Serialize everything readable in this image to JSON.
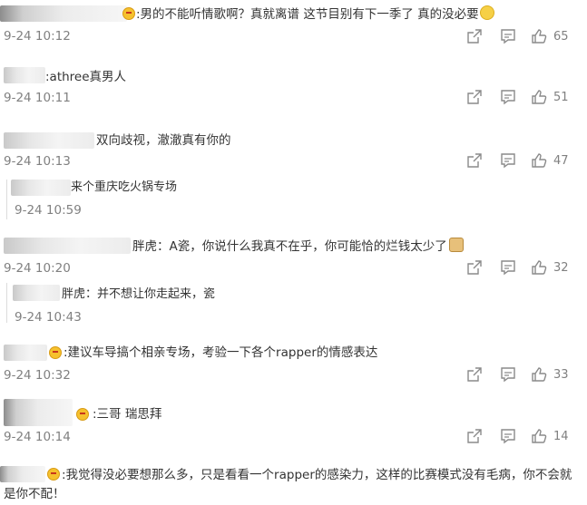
{
  "comments": [
    {
      "text": ":男的不能听情歌啊？真就离谱 这节目别有下一季了 真的没必要",
      "time": "9-24 10:12",
      "likes": "65"
    },
    {
      "text": ":athree真男人",
      "time": "9-24 10:11",
      "likes": "51"
    },
    {
      "text": "双向歧视，澈澈真有你的",
      "time": "9-24 10:13",
      "likes": "47",
      "reply": {
        "text": "来个重庆吃火锅专场",
        "time": "9-24 10:59"
      }
    },
    {
      "text": "胖虎：A瓷，你说什么我真不在乎，你可能恰的烂钱太少了",
      "time": "9-24 10:20",
      "likes": "32",
      "reply": {
        "text": "胖虎：并不想让你走起来，瓷",
        "time": "9-24 10:43"
      }
    },
    {
      "text": ":建议车导搞个相亲专场，考验一下各个rapper的情感表达",
      "time": "9-24 10:32",
      "likes": "33"
    },
    {
      "text": ":三哥 瑞思拜",
      "time": "9-24 10:14",
      "likes": "14"
    },
    {
      "text": ":我觉得没必要想那么多，只是看看一个rapper的感染力，这样的比赛模式没有毛病，你不会就是你不配！"
    }
  ],
  "icons": {
    "share": "share-icon",
    "comment": "comment-icon",
    "like": "like-icon",
    "vip_emoji": "vip-emoji-icon"
  }
}
